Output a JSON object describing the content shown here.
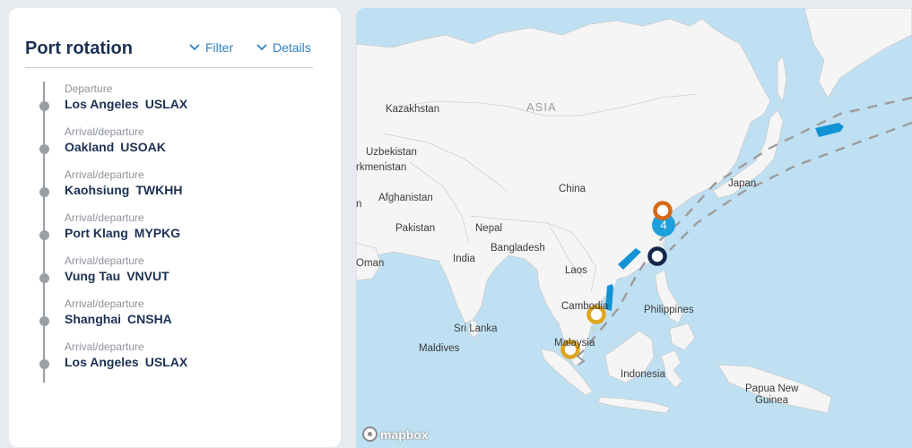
{
  "panel": {
    "title": "Port rotation",
    "filter_label": "Filter",
    "details_label": "Details"
  },
  "stops": [
    {
      "kind": "Departure",
      "port": "Los Angeles",
      "code": "USLAX"
    },
    {
      "kind": "Arrival/departure",
      "port": "Oakland",
      "code": "USOAK"
    },
    {
      "kind": "Arrival/departure",
      "port": "Kaohsiung",
      "code": "TWKHH"
    },
    {
      "kind": "Arrival/departure",
      "port": "Port Klang",
      "code": "MYPKG"
    },
    {
      "kind": "Arrival/departure",
      "port": "Vung Tau",
      "code": "VNVUT"
    },
    {
      "kind": "Arrival/departure",
      "port": "Shanghai",
      "code": "CNSHA"
    },
    {
      "kind": "Arrival/departure",
      "port": "Los Angeles",
      "code": "USLAX"
    }
  ],
  "map": {
    "labels": {
      "asia": "ASIA",
      "kazakhstan": "Kazakhstan",
      "uzbekistan": "Uzbekistan",
      "turkmenistan": "rkmenistan",
      "afghanistan": "Afghanistan",
      "iran": "n",
      "pakistan": "Pakistan",
      "nepal": "Nepal",
      "china": "China",
      "japan": "Japan",
      "bangladesh": "Bangladesh",
      "india": "India",
      "oman": "Oman",
      "laos": "Laos",
      "cambodia": "Cambodia",
      "philippines": "Philippines",
      "sri_lanka": "Sri Lanka",
      "maldives": "Maldives",
      "malaysia": "Malaysia",
      "indonesia": "Indonesia",
      "png_line1": "Papua New",
      "png_line2": "Guinea"
    },
    "cluster_count": "4",
    "attribution": "mapbox",
    "colors": {
      "water": "#bfe0f3",
      "land": "#f5f5f5",
      "route": "#9c9c9c",
      "vessel": "#1193d6",
      "cluster": "#1ea0dc",
      "marker_orange": "#d46a17",
      "marker_gold": "#e0a51c",
      "marker_navy": "#12264a"
    }
  }
}
